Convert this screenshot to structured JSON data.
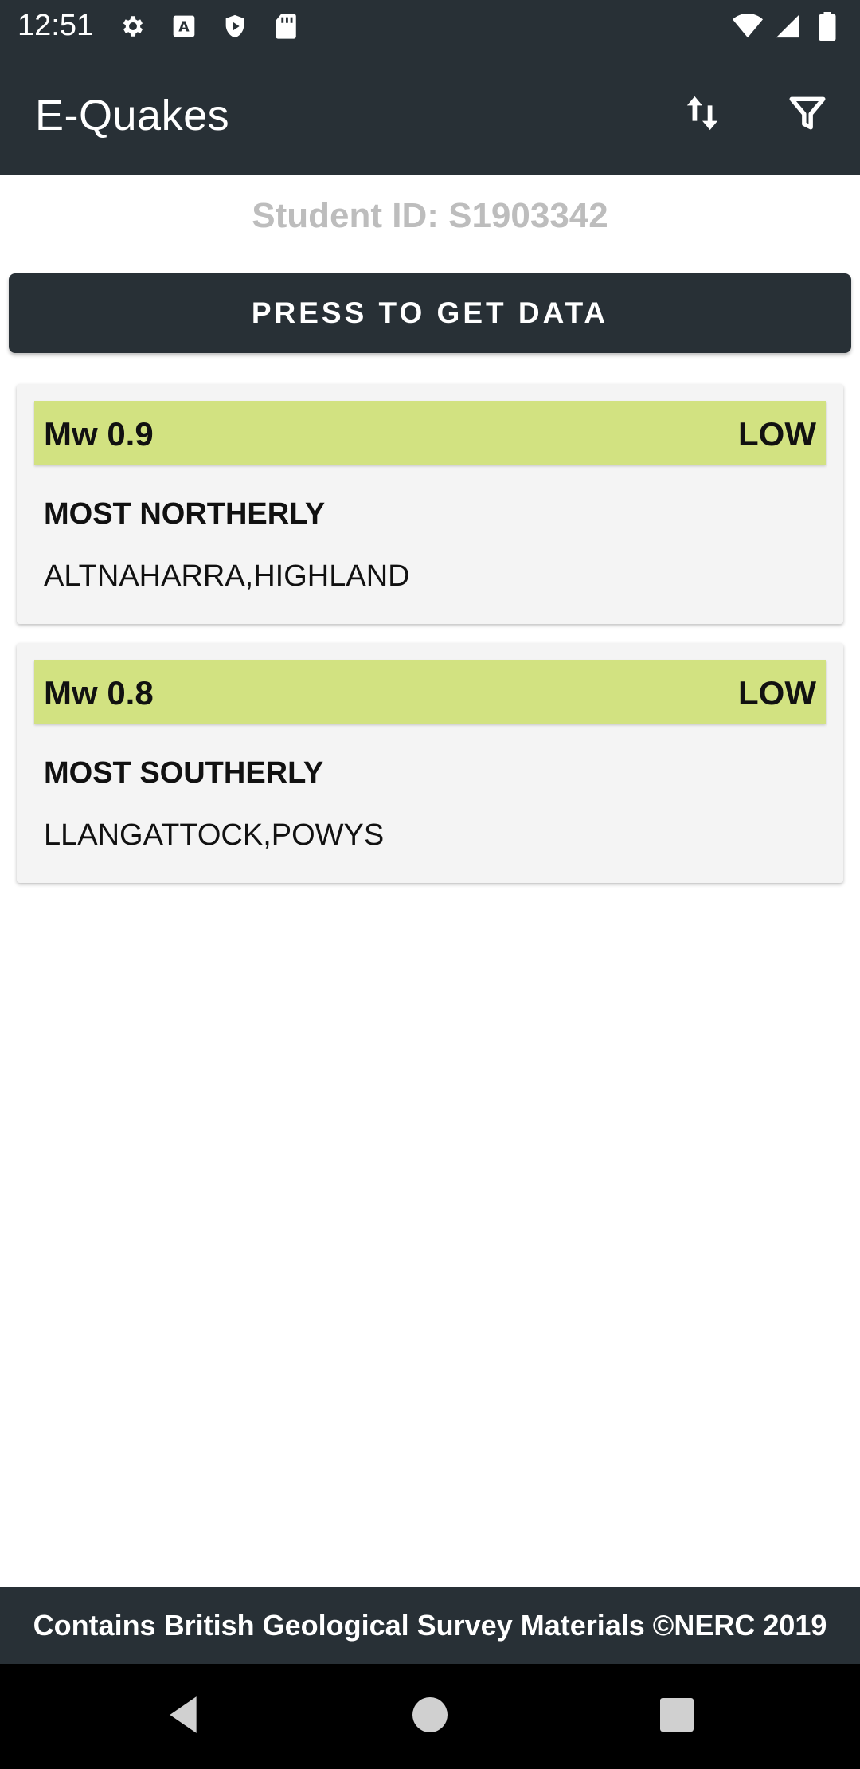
{
  "status_bar": {
    "time": "12:51",
    "left_icons": [
      "settings-icon",
      "font-a-icon",
      "shield-play-icon",
      "sd-card-icon"
    ],
    "right_icons": [
      "wifi-icon",
      "signal-icon",
      "battery-icon"
    ]
  },
  "app_bar": {
    "title": "E-Quakes",
    "actions": [
      "sort-icon",
      "filter-icon"
    ],
    "color": "#283036"
  },
  "student_id": "Student ID: S1903342",
  "get_data_button": {
    "label": "PRESS TO GET DATA"
  },
  "cards": [
    {
      "magnitude": "Mw 0.9",
      "level": "LOW",
      "heading": "MOST NORTHERLY",
      "location": "ALTNAHARRA,HIGHLAND",
      "level_color": "#d2e281"
    },
    {
      "magnitude": "Mw 0.8",
      "level": "LOW",
      "heading": "MOST SOUTHERLY",
      "location": "LLANGATTOCK,POWYS",
      "level_color": "#d2e281"
    }
  ],
  "footer": {
    "text": "Contains British Geological Survey Materials ©NERC 2019"
  },
  "nav_bar": {
    "buttons": [
      "back-icon",
      "home-icon",
      "recents-icon"
    ]
  }
}
